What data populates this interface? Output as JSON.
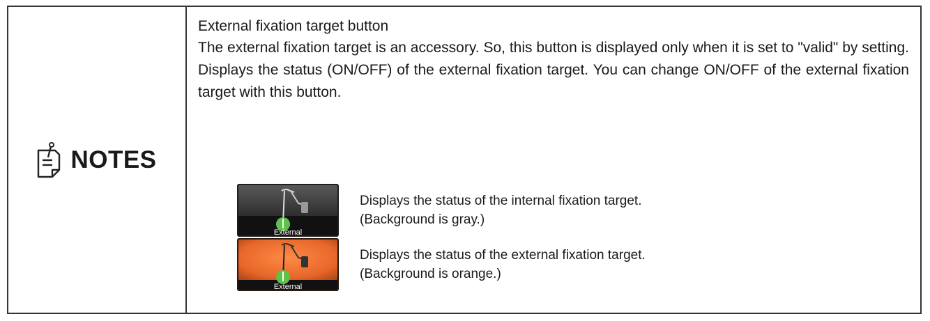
{
  "notes": {
    "label": "NOTES",
    "icon": "notes-pencil-icon"
  },
  "content": {
    "heading": "External fixation target button",
    "paragraph": "The external fixation target is an accessory.  So, this button is displayed only when it is set to \"valid\" by setting.  Displays the status (ON/OFF) of the external fixation target.  You can change ON/OFF of the external fixation target with this button."
  },
  "examples": [
    {
      "button_label": "External",
      "background": "gray",
      "background_color": "#3a3a3a",
      "description": "Displays the status of the internal fixation target.",
      "note": "(Background is gray.)"
    },
    {
      "button_label": "External",
      "background": "orange",
      "background_color": "#f07a3c",
      "description": "Displays the status of the external fixation target.",
      "note": "(Background is orange.)"
    }
  ],
  "colors": {
    "indicator_green": "#5cc24a",
    "border": "#333333"
  }
}
